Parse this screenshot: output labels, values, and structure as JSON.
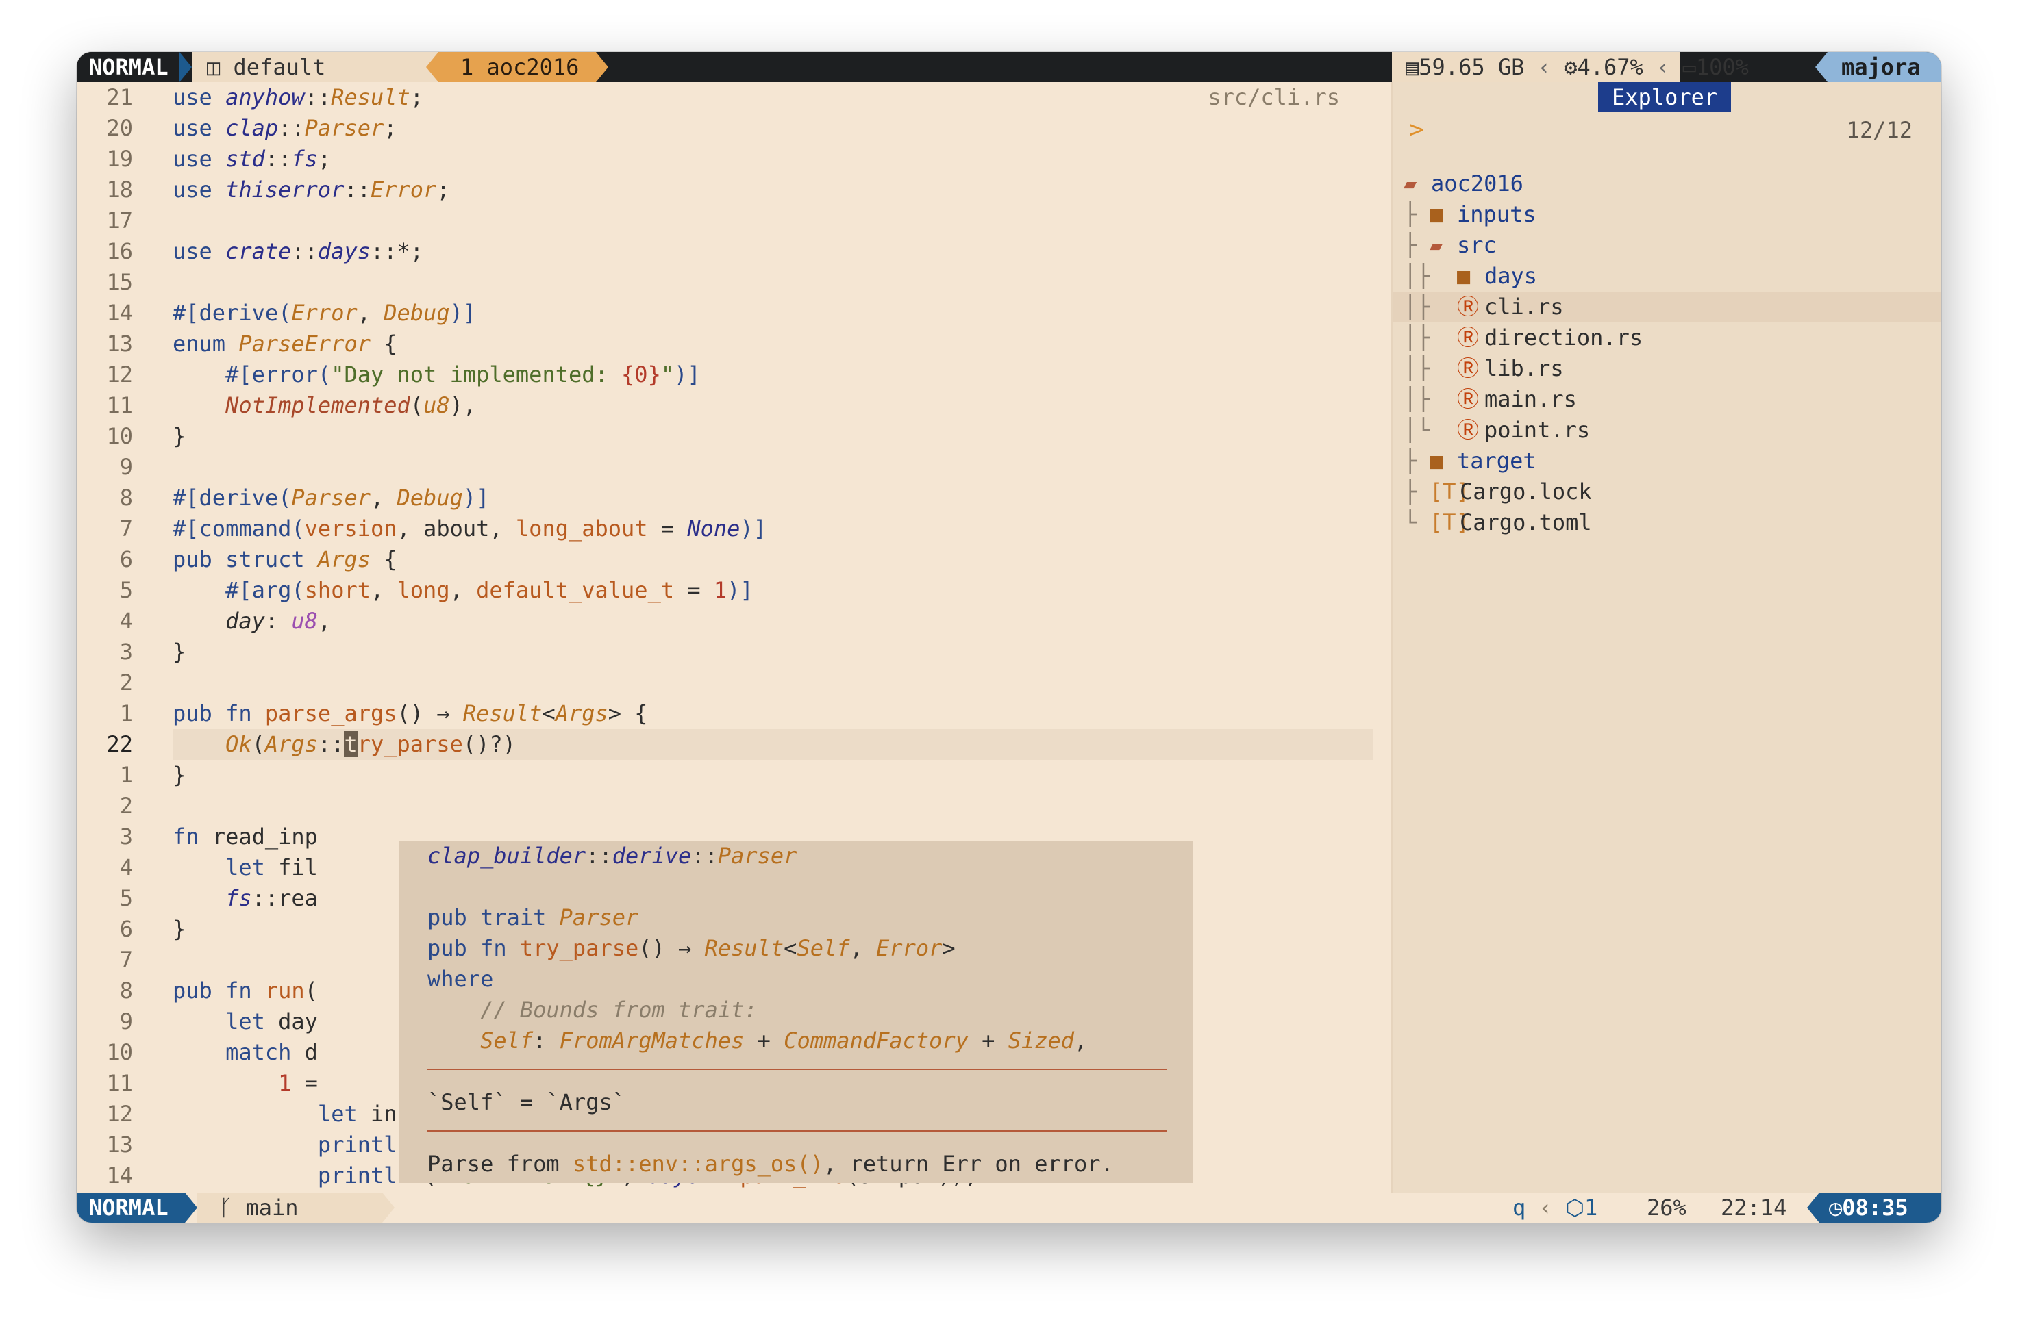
{
  "tabline": {
    "mode": "NORMAL",
    "layout": "default",
    "session": "1 aoc2016",
    "disk": "59.65 GB",
    "cpu": "4.67%",
    "battery": "100%",
    "host": "majora"
  },
  "editor": {
    "filename": "src/cli.rs",
    "gutter": [
      "21",
      "20",
      "19",
      "18",
      "17",
      "16",
      "15",
      "14",
      "13",
      "12",
      "11",
      "10",
      "9",
      "8",
      "7",
      "6",
      "5",
      "4",
      "3",
      "2",
      "1",
      "22",
      "1",
      "2",
      "3",
      "4",
      "5",
      "6",
      "7",
      "8",
      "9",
      "10",
      "11",
      "12",
      "13",
      "14"
    ],
    "current_line_number": "22"
  },
  "hover": {
    "path": "clap_builder::derive::Parser",
    "comment": "// Bounds from trait:",
    "self_eq": "`Self` = `Args`",
    "doc": "Parse from std::env::args_os(), return Err on error."
  },
  "explorer": {
    "title": "Explorer",
    "prompt": ">",
    "count": "12/12",
    "tree": [
      {
        "label": "aoc2016",
        "icon": "folder-open-icon",
        "depth": 0,
        "prefix": ""
      },
      {
        "label": "inputs",
        "icon": "folder-icon",
        "depth": 1,
        "prefix": "├"
      },
      {
        "label": "src",
        "icon": "folder-open-icon",
        "depth": 1,
        "prefix": "├"
      },
      {
        "label": "days",
        "icon": "folder-icon",
        "depth": 2,
        "prefix": "│├"
      },
      {
        "label": "cli.rs",
        "icon": "rust-icon",
        "depth": 2,
        "prefix": "│├"
      },
      {
        "label": "direction.rs",
        "icon": "rust-icon",
        "depth": 2,
        "prefix": "│├"
      },
      {
        "label": "lib.rs",
        "icon": "rust-icon",
        "depth": 2,
        "prefix": "│├"
      },
      {
        "label": "main.rs",
        "icon": "rust-icon",
        "depth": 2,
        "prefix": "│├"
      },
      {
        "label": "point.rs",
        "icon": "rust-icon",
        "depth": 2,
        "prefix": "│└"
      },
      {
        "label": "target",
        "icon": "folder-icon",
        "depth": 1,
        "prefix": "├"
      },
      {
        "label": "Cargo.lock",
        "icon": "toml-icon",
        "depth": 1,
        "prefix": "├"
      },
      {
        "label": "Cargo.toml",
        "icon": "toml-icon",
        "depth": 1,
        "prefix": "└"
      }
    ]
  },
  "statusline": {
    "mode": "NORMAL",
    "branch": "main",
    "recording": "q",
    "diagnostics": "1",
    "percent": "26%",
    "position": "22:14",
    "clock": "08:35"
  },
  "colors": {
    "background": "#f5e6d3",
    "mode_blue": "#1d5a8e",
    "session_orange": "#e6a24e",
    "explorer_title": "#1d3d8c"
  }
}
